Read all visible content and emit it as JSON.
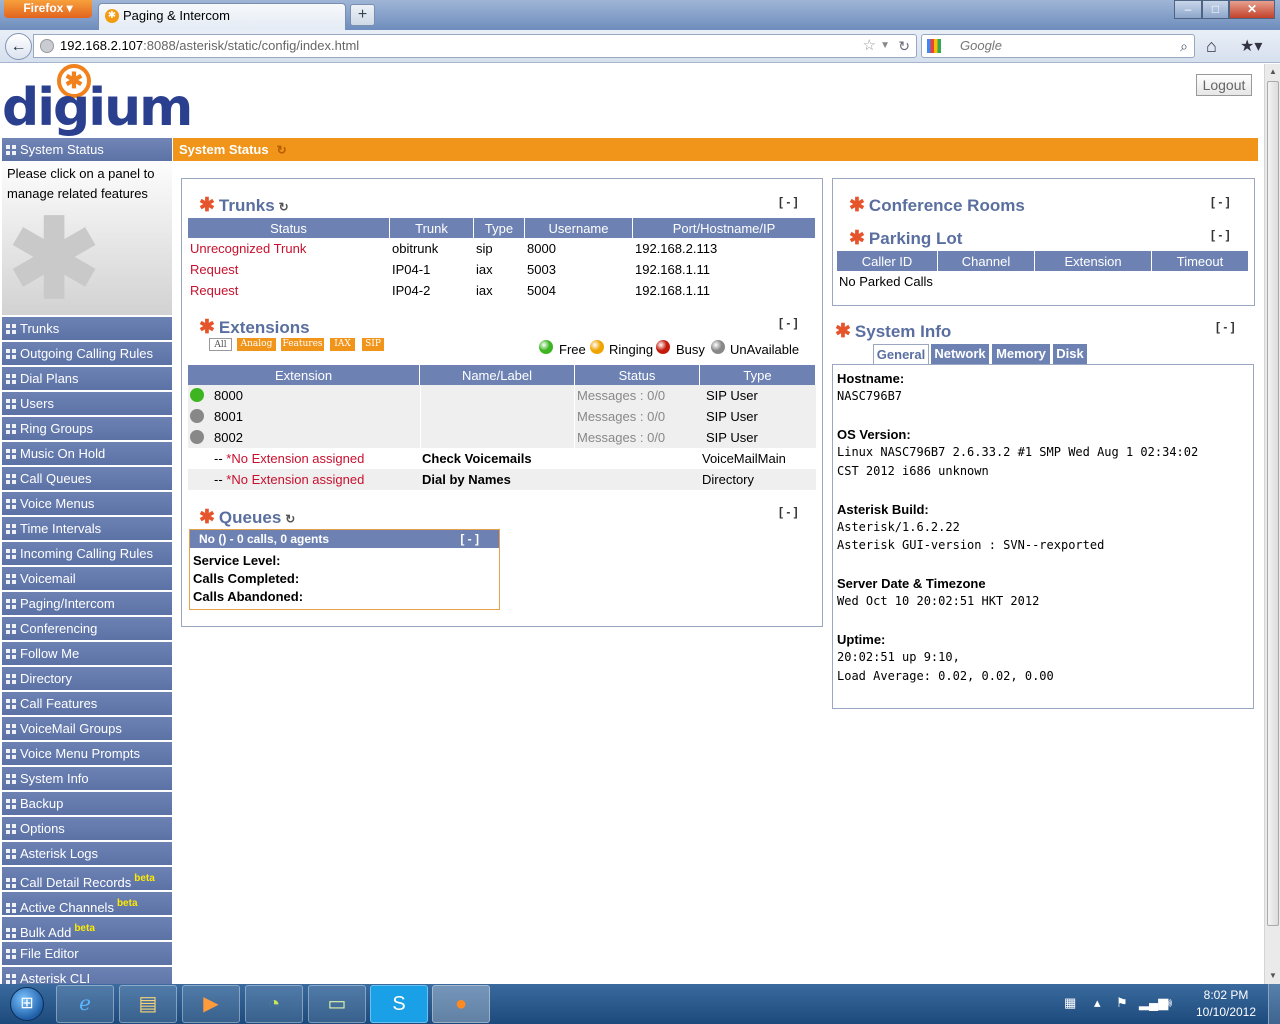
{
  "browser": {
    "app_button": "Firefox",
    "tab_title": "Paging & Intercom",
    "new_tab": "+",
    "url_host": "192.168.2.107",
    "url_path": ":8088/asterisk/static/config/index.html",
    "search_placeholder": "Google",
    "window_buttons": {
      "minimize": "–",
      "maximize": "□",
      "close": "✕"
    }
  },
  "header": {
    "logo_text": "digium",
    "logout_label": "Logout"
  },
  "sidebar": {
    "status_item": "System Status",
    "help_text": "Please click on a panel to manage related features",
    "items": [
      {
        "label": "Trunks",
        "beta": ""
      },
      {
        "label": "Outgoing Calling Rules",
        "beta": ""
      },
      {
        "label": "Dial Plans",
        "beta": ""
      },
      {
        "label": "Users",
        "beta": ""
      },
      {
        "label": "Ring Groups",
        "beta": ""
      },
      {
        "label": "Music On Hold",
        "beta": ""
      },
      {
        "label": "Call Queues",
        "beta": ""
      },
      {
        "label": "Voice Menus",
        "beta": ""
      },
      {
        "label": "Time Intervals",
        "beta": ""
      },
      {
        "label": "Incoming Calling Rules",
        "beta": ""
      },
      {
        "label": "Voicemail",
        "beta": ""
      },
      {
        "label": "Paging/Intercom",
        "beta": ""
      },
      {
        "label": "Conferencing",
        "beta": ""
      },
      {
        "label": "Follow Me",
        "beta": ""
      },
      {
        "label": "Directory",
        "beta": ""
      },
      {
        "label": "Call Features",
        "beta": ""
      },
      {
        "label": "VoiceMail Groups",
        "beta": ""
      },
      {
        "label": "Voice Menu Prompts",
        "beta": ""
      },
      {
        "label": "System Info",
        "beta": ""
      },
      {
        "label": "Backup",
        "beta": ""
      },
      {
        "label": "Options",
        "beta": ""
      },
      {
        "label": "Asterisk Logs",
        "beta": ""
      },
      {
        "label": "Call Detail Records",
        "beta": "beta"
      },
      {
        "label": "Active Channels",
        "beta": "beta"
      },
      {
        "label": "Bulk Add",
        "beta": "beta"
      },
      {
        "label": "File Editor",
        "beta": ""
      },
      {
        "label": "Asterisk CLI",
        "beta": ""
      }
    ]
  },
  "main": {
    "title": "System Status",
    "collapse": "[ - ]",
    "trunks": {
      "title": "Trunks",
      "headers": [
        "Status",
        "Trunk",
        "Type",
        "Username",
        "Port/Hostname/IP"
      ],
      "rows": [
        [
          "Unrecognized Trunk",
          "obitrunk",
          "sip",
          "8000",
          "192.168.2.113"
        ],
        [
          "Request",
          "IP04-1",
          "iax",
          "5003",
          "192.168.1.11"
        ],
        [
          "Request",
          "IP04-2",
          "iax",
          "5004",
          "192.168.1.11"
        ]
      ]
    },
    "extensions": {
      "title": "Extensions",
      "filters": [
        "All",
        "Analog",
        "Features",
        "IAX",
        "SIP"
      ],
      "legend": [
        {
          "label": "Free",
          "color": "#3cb521"
        },
        {
          "label": "Ringing",
          "color": "#f0a400"
        },
        {
          "label": "Busy",
          "color": "#c41a0c"
        },
        {
          "label": "UnAvailable",
          "color": "#888888"
        }
      ],
      "headers": [
        "Extension",
        "Name/Label",
        "Status",
        "Type"
      ],
      "rows": [
        {
          "ext": "8000",
          "name": "",
          "status": "Messages : 0/0",
          "type": "SIP User",
          "dot": "#3cb521"
        },
        {
          "ext": "8001",
          "name": "",
          "status": "Messages : 0/0",
          "type": "SIP User",
          "dot": "#888888"
        },
        {
          "ext": "8002",
          "name": "",
          "status": "Messages : 0/0",
          "type": "SIP User",
          "dot": "#888888"
        }
      ],
      "feature_rows": [
        {
          "prefix": "--",
          "ext": "*No Extension assigned",
          "name": "Check Voicemails",
          "type": "VoiceMailMain"
        },
        {
          "prefix": "--",
          "ext": "*No Extension assigned",
          "name": "Dial by Names",
          "type": "Directory"
        }
      ]
    },
    "queues": {
      "title": "Queues",
      "queue_head": "No () - 0 calls, 0 agents",
      "lines": [
        "Service Level:",
        "Calls Completed:",
        "Calls Abandoned:"
      ]
    },
    "conference": {
      "title": "Conference Rooms"
    },
    "parking": {
      "title": "Parking Lot",
      "headers": [
        "Caller ID",
        "Channel",
        "Extension",
        "Timeout"
      ],
      "empty": "No Parked Calls"
    },
    "sysinfo": {
      "title": "System Info",
      "tabs": [
        "General",
        "Network",
        "Memory",
        "Disk"
      ],
      "hostname_label": "Hostname:",
      "hostname": "NASC796B7",
      "os_label": "OS Version:",
      "os_line1": "Linux NASC796B7 2.6.33.2 #1 SMP Wed Aug 1 02:34:02",
      "os_line2": "CST 2012 i686 unknown",
      "build_label": "Asterisk Build:",
      "build_line1": "Asterisk/1.6.2.22",
      "build_line2": "Asterisk GUI-version : SVN--rexported",
      "date_label": "Server Date & Timezone",
      "date": "Wed Oct 10 20:02:51 HKT 2012",
      "uptime_label": "Uptime:",
      "uptime_line1": "20:02:51 up 9:10,",
      "uptime_line2": "Load Average: 0.02, 0.02, 0.00"
    }
  },
  "taskbar": {
    "time": "8:02 PM",
    "date": "10/10/2012"
  },
  "colors": {
    "accent": "#f0941a",
    "nav": "#6d82b3",
    "title": "#5a6fa0",
    "star": "#e5542a",
    "link_red": "#c8102e"
  }
}
